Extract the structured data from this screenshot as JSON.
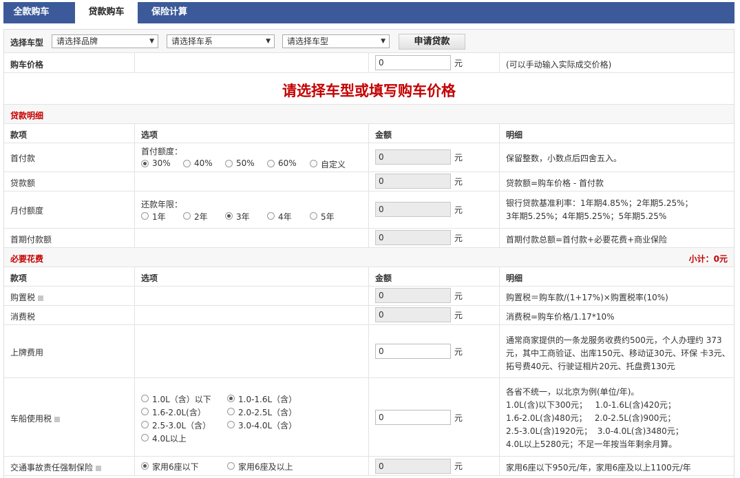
{
  "tabs": [
    "全款购车",
    "贷款购车",
    "保险计算"
  ],
  "select_row": {
    "label": "选择车型",
    "brand": "请选择品牌",
    "series": "请选择车系",
    "model": "请选择车型",
    "apply": "申请贷款"
  },
  "price_row": {
    "label": "购车价格",
    "value": "0",
    "unit": "元",
    "note": "(可以手动输入实际成交价格)"
  },
  "hint": "请选择车型或填写购车价格",
  "loan": {
    "title": "贷款明细",
    "headers": [
      "款项",
      "选项",
      "金额",
      "明细"
    ],
    "down_payment": {
      "label": "首付款",
      "opt_label": "首付额度：",
      "options": [
        "30%",
        "40%",
        "50%",
        "60%",
        "自定义"
      ],
      "selected": 0,
      "value": "0",
      "unit": "元",
      "note": "保留整数，小数点后四舍五入。"
    },
    "loan_amount": {
      "label": "贷款额",
      "value": "0",
      "unit": "元",
      "note": "贷款额=购车价格 - 首付款"
    },
    "monthly": {
      "label": "月付额度",
      "opt_label": "还款年限：",
      "options": [
        "1年",
        "2年",
        "3年",
        "4年",
        "5年"
      ],
      "selected": 2,
      "value": "0",
      "unit": "元",
      "note1": "银行贷款基准利率：1年期4.85%；2年期5.25%；",
      "note2": "3年期5.25%；4年期5.25%；5年期5.25%"
    },
    "first": {
      "label": "首期付款额",
      "value": "0",
      "unit": "元",
      "note": "首期付款总额=首付款+必要花费+商业保险"
    }
  },
  "necessary": {
    "title": "必要花费",
    "subtotal": "小计：0元",
    "headers": [
      "款项",
      "选项",
      "金额",
      "明细"
    ],
    "purchase_tax": {
      "label": "购置税",
      "value": "0",
      "unit": "元",
      "note": "购置税＝购车款/(1+17%)×购置税率(10%)"
    },
    "consumption_tax": {
      "label": "消费税",
      "value": "0",
      "unit": "元",
      "note": "消费税=购车价格/1.17*10%"
    },
    "plate": {
      "label": "上牌费用",
      "value": "0",
      "unit": "元",
      "note1": "通常商家提供的一条龙服务收费约500元，个人办理约 373",
      "note2": "元，其中工商验证、出库150元、移动证30元、环保 卡3元、",
      "note3": "拓号费40元、行驶证相片20元、托盘费130元"
    },
    "vessel": {
      "label": "车船使用税",
      "value": "0",
      "unit": "元",
      "options": [
        "1.0L（含）以下",
        "1.0-1.6L（含）",
        "1.6-2.0L(含）",
        "2.0-2.5L（含）",
        "2.5-3.0L（含）",
        "3.0-4.0L（含）",
        "4.0L以上"
      ],
      "selected": 1,
      "note1": "各省不统一，以北京为例(单位/年)。",
      "note2": "1.0L(含)以下300元；   1.0-1.6L(含)420元；",
      "note3": "1.6-2.0L(含)480元；   2.0-2.5L(含)900元；",
      "note4": "2.5-3.0L(含)1920元；  3.0-4.0L(含)3480元；",
      "note5": "4.0L以上5280元；不足一年按当年剩余月算。"
    },
    "compulsory": {
      "label": "交通事故责任强制保险",
      "value": "0",
      "unit": "元",
      "options": [
        "家用6座以下",
        "家用6座及以上"
      ],
      "selected": 0,
      "note": "家用6座以下950元/年，家用6座及以上1100元/年"
    }
  }
}
